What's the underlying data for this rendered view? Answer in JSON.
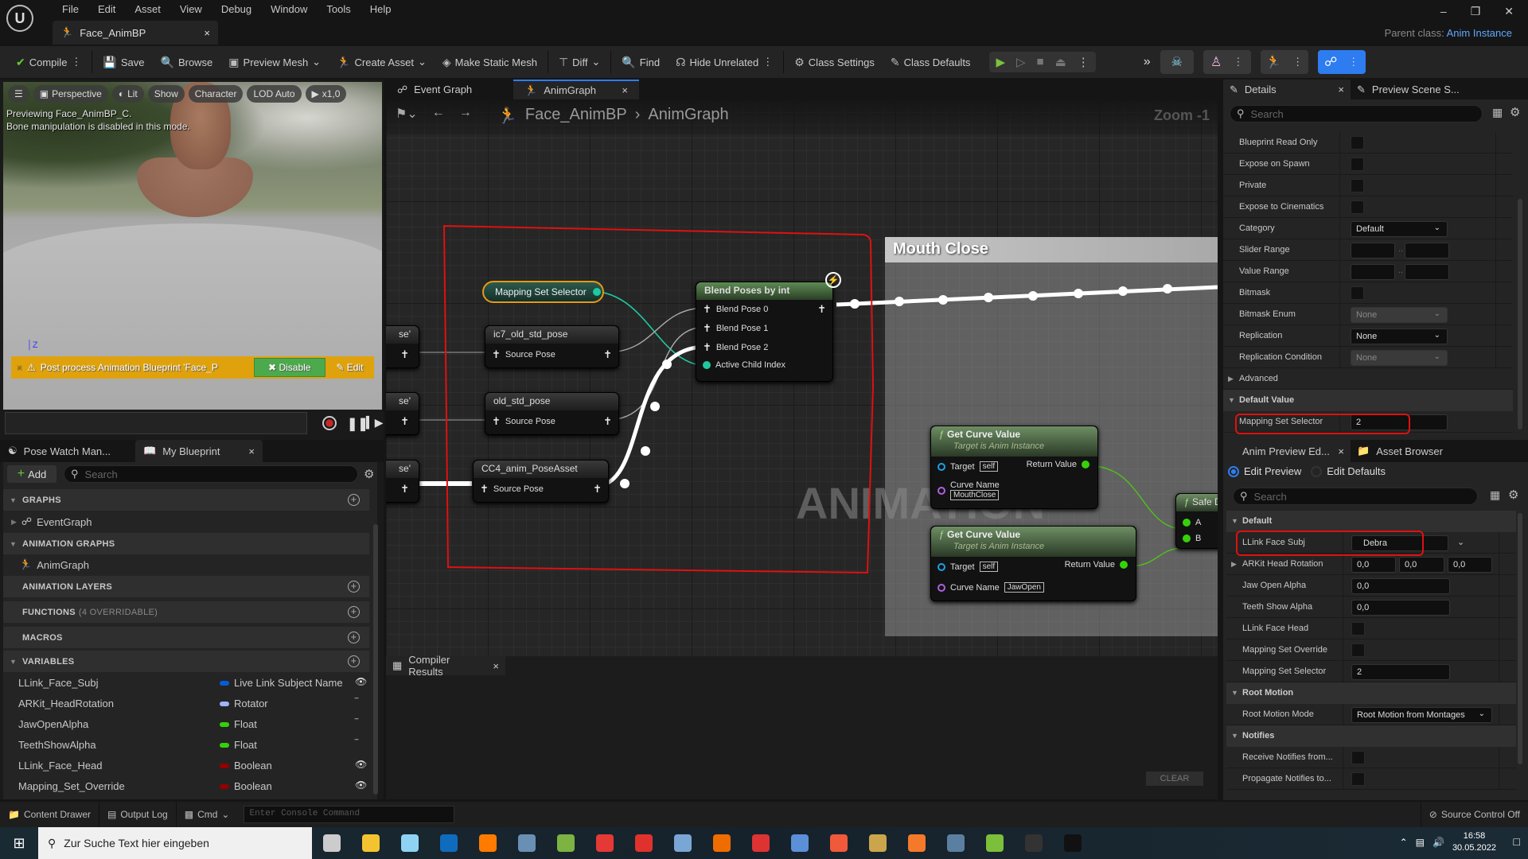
{
  "app": {
    "menu": [
      "File",
      "Edit",
      "Asset",
      "View",
      "Debug",
      "Window",
      "Tools",
      "Help"
    ],
    "document_tab": "Face_AnimBP",
    "parent_class_label": "Parent class:",
    "parent_class_value": "Anim Instance"
  },
  "toolbar": {
    "compile": "Compile",
    "save": "Save",
    "browse": "Browse",
    "preview_mesh": "Preview Mesh",
    "create_asset": "Create Asset",
    "make_static_mesh": "Make Static Mesh",
    "diff": "Diff",
    "find": "Find",
    "hide_unrelated": "Hide Unrelated",
    "class_settings": "Class Settings",
    "class_defaults": "Class Defaults"
  },
  "viewport": {
    "perspective": "Perspective",
    "lit": "Lit",
    "show": "Show",
    "character": "Character",
    "lod": "LOD Auto",
    "speed": "x1,0",
    "info_line1": "Previewing Face_AnimBP_C.",
    "info_line2": "Bone manipulation is disabled in this mode.",
    "axis_label": "Z",
    "warning": "Post process Animation Blueprint 'Face_P",
    "disable": "Disable",
    "edit": "Edit"
  },
  "my_blueprint": {
    "tabs": [
      "Pose Watch Man...",
      "My Blueprint"
    ],
    "add": "Add",
    "search_placeholder": "Search",
    "sections": {
      "graphs": "GRAPHS",
      "event_graph": "EventGraph",
      "animation_graphs": "ANIMATION GRAPHS",
      "anim_graph": "AnimGraph",
      "animation_layers": "ANIMATION LAYERS",
      "functions": "FUNCTIONS",
      "functions_sub": "(4 OVERRIDABLE)",
      "macros": "MACROS",
      "variables": "VARIABLES"
    },
    "variables": [
      {
        "name": "LLink_Face_Subj",
        "type": "Live Link Subject Name",
        "color": "#0a5ad8",
        "visible": true
      },
      {
        "name": "ARKit_HeadRotation",
        "type": "Rotator",
        "color": "#9db4ff",
        "visible": false
      },
      {
        "name": "JawOpenAlpha",
        "type": "Float",
        "color": "#35d10a",
        "visible": false
      },
      {
        "name": "TeethShowAlpha",
        "type": "Float",
        "color": "#35d10a",
        "visible": false
      },
      {
        "name": "LLink_Face_Head",
        "type": "Boolean",
        "color": "#940000",
        "visible": true
      },
      {
        "name": "Mapping_Set_Override",
        "type": "Boolean",
        "color": "#940000",
        "visible": true
      }
    ]
  },
  "graph": {
    "tabs": [
      "Event Graph",
      "AnimGraph"
    ],
    "breadcrumb": [
      "Face_AnimBP",
      "AnimGraph"
    ],
    "zoom": "Zoom -1",
    "watermark": "ANIMATION",
    "comment_title": "Mouth Close",
    "nodes": {
      "selector": "Mapping Set Selector",
      "blend_title": "Blend Poses by int",
      "blend_pins": [
        "Blend Pose 0",
        "Blend Pose 1",
        "Blend Pose 2",
        "Active Child Index"
      ],
      "pose_nodes": [
        {
          "title": "ic7_old_std_pose",
          "pin": "Source Pose"
        },
        {
          "title": "old_std_pose",
          "pin": "Source Pose"
        },
        {
          "title": "CC4_anim_PoseAsset",
          "pin": "Source Pose"
        }
      ],
      "partial_label": "se'",
      "curve_nodes": [
        {
          "title": "Get Curve Value",
          "subtitle": "Target is Anim Instance",
          "target": "Target",
          "self": "self",
          "curve_label": "Curve Name",
          "curve_value": "MouthClose",
          "return": "Return Value"
        },
        {
          "title": "Get Curve Value",
          "subtitle": "Target is Anim Instance",
          "target": "Target",
          "self": "self",
          "curve_label": "Curve Name",
          "curve_value": "JawOpen",
          "return": "Return Value"
        }
      ],
      "safe_title": "Safe D",
      "safe_pins": [
        "A",
        "B"
      ]
    }
  },
  "compiler": {
    "tab": "Compiler Results",
    "clear": "CLEAR"
  },
  "details": {
    "tabs": [
      "Details",
      "Preview Scene S..."
    ],
    "search_placeholder": "Search",
    "rows": [
      {
        "label": "Blueprint Read Only",
        "kind": "check"
      },
      {
        "label": "Expose on Spawn",
        "kind": "check"
      },
      {
        "label": "Private",
        "kind": "check"
      },
      {
        "label": "Expose to Cinematics",
        "kind": "check"
      },
      {
        "label": "Category",
        "kind": "combo",
        "value": "Default"
      },
      {
        "label": "Slider Range",
        "kind": "range"
      },
      {
        "label": "Value Range",
        "kind": "range"
      },
      {
        "label": "Bitmask",
        "kind": "check"
      },
      {
        "label": "Bitmask Enum",
        "kind": "select-disabled",
        "value": "None"
      },
      {
        "label": "Replication",
        "kind": "select",
        "value": "None"
      },
      {
        "label": "Replication Condition",
        "kind": "select-disabled",
        "value": "None"
      }
    ],
    "advanced": "Advanced",
    "default_value_header": "Default Value",
    "default_value_row": {
      "label": "Mapping Set Selector",
      "value": "2"
    }
  },
  "anim_preview": {
    "tabs": [
      "Anim Preview Ed...",
      "Asset Browser"
    ],
    "edit_preview": "Edit Preview",
    "edit_defaults": "Edit Defaults",
    "search_placeholder": "Search",
    "default_header": "Default",
    "face_subj": {
      "label": "LLink Face Subj",
      "value": "Debra"
    },
    "head_rotation": {
      "label": "ARKit Head Rotation",
      "values": [
        "0,0",
        "0,0",
        "0,0"
      ]
    },
    "jaw_open": {
      "label": "Jaw Open Alpha",
      "value": "0,0"
    },
    "teeth_show": {
      "label": "Teeth Show Alpha",
      "value": "0,0"
    },
    "face_head": {
      "label": "LLink Face Head"
    },
    "mapping_override": {
      "label": "Mapping Set Override"
    },
    "mapping_selector": {
      "label": "Mapping Set Selector",
      "value": "2"
    },
    "root_motion_header": "Root Motion",
    "root_motion_mode": {
      "label": "Root Motion Mode",
      "value": "Root Motion from Montages"
    },
    "notifies_header": "Notifies",
    "receive_notifies": "Receive Notifies from...",
    "propagate_notifies": "Propagate Notifies to..."
  },
  "statusbar": {
    "content_drawer": "Content Drawer",
    "output_log": "Output Log",
    "cmd": "Cmd",
    "console_placeholder": "Enter Console Command",
    "source_control": "Source Control Off"
  },
  "taskbar": {
    "search_placeholder": "Zur Suche Text hier eingeben",
    "apps": [
      {
        "name": "task-view",
        "color": "#ccc"
      },
      {
        "name": "file-explorer",
        "color": "#f4c430"
      },
      {
        "name": "notepad",
        "color": "#8fd3f4"
      },
      {
        "name": "outlook",
        "color": "#0f6cbd"
      },
      {
        "name": "firefox",
        "color": "#ff7b00"
      },
      {
        "name": "document-app",
        "color": "#6a8fb5"
      },
      {
        "name": "spreadsheet-app",
        "color": "#7cb342"
      },
      {
        "name": "chrome",
        "color": "#e53935"
      },
      {
        "name": "pdf-app",
        "color": "#e0322c"
      },
      {
        "name": "paint-app",
        "color": "#7aa6d6"
      },
      {
        "name": "color-wheel-app",
        "color": "#ef6c00"
      },
      {
        "name": "brush-app",
        "color": "#d33"
      },
      {
        "name": "remote-app",
        "color": "#5b8fd8"
      },
      {
        "name": "origin-app",
        "color": "#f05a3a"
      },
      {
        "name": "daz-studio",
        "color": "#caa54b"
      },
      {
        "name": "blender",
        "color": "#f5792a"
      },
      {
        "name": "character-creator",
        "color": "#5a7fa0"
      },
      {
        "name": "iclone",
        "color": "#7bbf3a"
      },
      {
        "name": "r-app",
        "color": "#333"
      },
      {
        "name": "unreal-engine",
        "color": "#111"
      }
    ],
    "time": "16:58",
    "date": "30.05.2022"
  },
  "colors": {
    "accent": "#2d7cf0",
    "warning": "#e0a20c",
    "annotation": "#e01010",
    "exec_node": "#6e8e64"
  }
}
